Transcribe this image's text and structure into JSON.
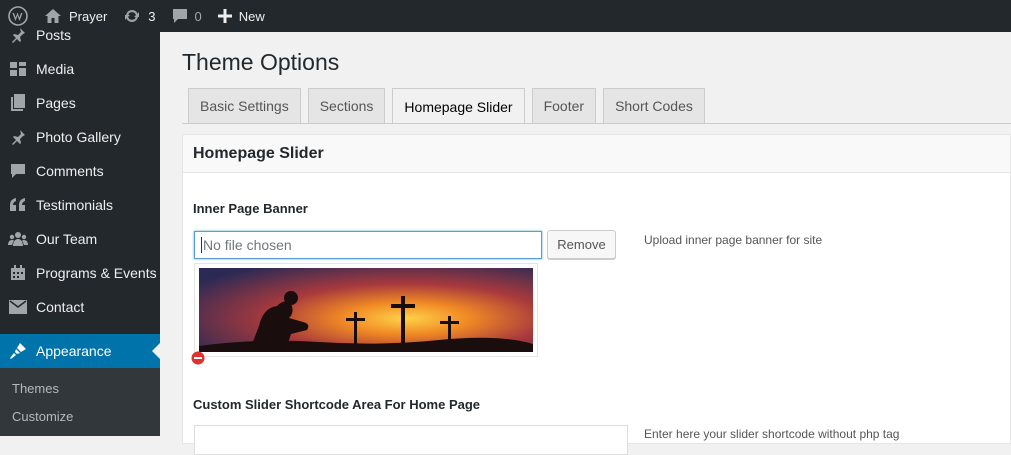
{
  "adminbar": {
    "site_name": "Prayer",
    "updates_count": "3",
    "comments_count": "0",
    "new_label": "New"
  },
  "sidebar": {
    "items": [
      {
        "label": "Posts",
        "icon": "pin-icon"
      },
      {
        "label": "Media",
        "icon": "media-icon"
      },
      {
        "label": "Pages",
        "icon": "pages-icon"
      },
      {
        "label": "Photo Gallery",
        "icon": "pin-icon"
      },
      {
        "label": "Comments",
        "icon": "comment-icon"
      },
      {
        "label": "Testimonials",
        "icon": "quote-icon"
      },
      {
        "label": "Our Team",
        "icon": "groups-icon"
      },
      {
        "label": "Programs & Events",
        "icon": "calendar-icon"
      },
      {
        "label": "Contact",
        "icon": "email-icon"
      },
      {
        "label": "Appearance",
        "icon": "brush-icon"
      }
    ],
    "submenu": [
      {
        "label": "Themes"
      },
      {
        "label": "Customize"
      }
    ]
  },
  "page": {
    "title": "Theme Options",
    "tabs": [
      {
        "label": "Basic Settings"
      },
      {
        "label": "Sections"
      },
      {
        "label": "Homepage Slider"
      },
      {
        "label": "Footer"
      },
      {
        "label": "Short Codes"
      }
    ],
    "active_tab": "Homepage Slider"
  },
  "panel": {
    "heading": "Homepage Slider",
    "banner_label": "Inner Page Banner",
    "file_placeholder": "No file chosen",
    "remove_label": "Remove",
    "banner_desc": "Upload inner page banner for site",
    "shortcode_label": "Custom Slider Shortcode Area For Home Page",
    "shortcode_desc": "Enter here your slider shortcode without php tag"
  },
  "colors": {
    "adminbar_bg": "#23282d",
    "accent": "#0073aa",
    "remove_icon": "#dc3232"
  }
}
